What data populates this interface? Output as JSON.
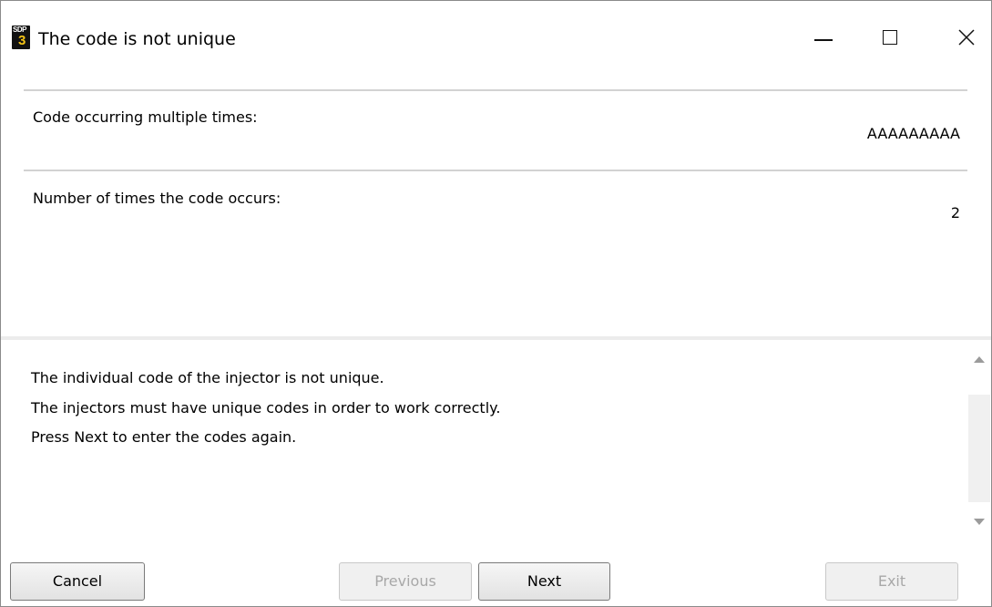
{
  "window": {
    "title": "The code is not unique",
    "icon": {
      "top_text": "SDP",
      "bottom_text": "3",
      "name": "sdp3-app-icon"
    }
  },
  "fields": [
    {
      "label": "Code occurring multiple times:",
      "value": "AAAAAAAAA"
    },
    {
      "label": "Number of times the code occurs:",
      "value": "2"
    }
  ],
  "message": {
    "lines": [
      "The individual code of the injector is not unique.",
      "The injectors must have unique codes in order to work correctly.",
      "Press Next to enter the codes again."
    ]
  },
  "buttons": {
    "cancel": "Cancel",
    "previous": "Previous",
    "next": "Next",
    "exit": "Exit"
  },
  "colors": {
    "icon_accent": "#f3c317",
    "separator": "#d2d2d2",
    "disabled_text": "#a8a8a8"
  }
}
